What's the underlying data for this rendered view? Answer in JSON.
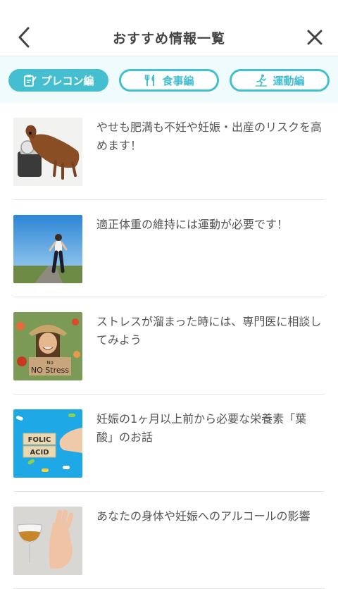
{
  "header": {
    "title": "おすすめ情報一覧",
    "back_icon": "chevron-left-icon",
    "close_icon": "close-icon"
  },
  "tabs": [
    {
      "label": "プレコン編",
      "icon": "clipboard-pen-icon",
      "active": true
    },
    {
      "label": "食事編",
      "icon": "fork-knife-icon",
      "active": false
    },
    {
      "label": "運動編",
      "icon": "running-person-icon",
      "active": false
    }
  ],
  "articles": [
    {
      "title": "やせも肥満も不妊や妊娠・出産のリスクを高めます！",
      "image": "dog-on-scale"
    },
    {
      "title": "適正体重の維持には運動が必要です！",
      "image": "woman-walking-road"
    },
    {
      "title": "ストレスが溜まった時には、専門医に相談してみよう",
      "image": "woman-no-stress-sign",
      "sign_line1": "No",
      "sign_line2": "NO Stress"
    },
    {
      "title": "妊娠の1ヶ月以上前から必要な栄養素「葉酸」のお話",
      "image": "folic-acid-blocks",
      "block_line1": "FOLIC",
      "block_line2": "ACID"
    },
    {
      "title": "あなたの身体や妊娠へのアルコールの影響",
      "image": "hand-refusing-wine"
    }
  ],
  "colors": {
    "accent": "#45bfd0",
    "tab_bar_bg": "#f0fbfd",
    "text": "#444444"
  }
}
